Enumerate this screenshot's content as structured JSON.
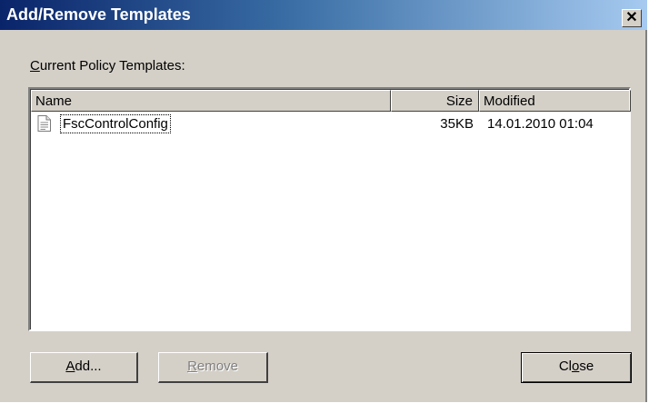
{
  "window": {
    "title": "Add/Remove Templates",
    "close_glyph": "✕"
  },
  "section_label": {
    "mnemonic": "C",
    "rest": "urrent Policy Templates:"
  },
  "list": {
    "columns": [
      "Name",
      "Size",
      "Modified"
    ],
    "rows": [
      {
        "icon": "document-icon",
        "name": "FscControlConfig",
        "size": "35KB",
        "modified": "14.01.2010 01:04"
      }
    ]
  },
  "buttons": {
    "add": {
      "mnemonic": "A",
      "rest": "dd..."
    },
    "remove": {
      "mnemonic": "R",
      "rest": "emove",
      "enabled": false
    },
    "close": {
      "pre": "Cl",
      "mnemonic": "o",
      "rest": "se"
    }
  }
}
